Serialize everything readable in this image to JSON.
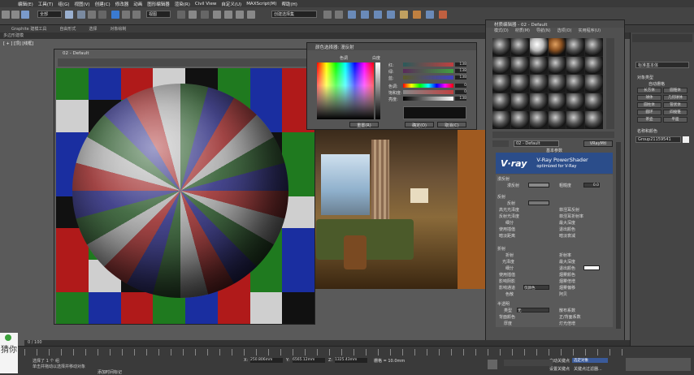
{
  "menubar": {
    "items": [
      "编辑(E)",
      "工具(T)",
      "组(G)",
      "视图(V)",
      "创建(C)",
      "修改器",
      "动画",
      "图形编辑器",
      "渲染(R)",
      "Civil View",
      "自定义(U)",
      "MAXScript(M)",
      "帮助(H)"
    ]
  },
  "toolbar": {
    "selection_filter": "全部",
    "view_dropdown": "视图",
    "named_selection": "创建选择集"
  },
  "ribbon": {
    "tabs": [
      "Graphite 建模工具",
      "自由形式",
      "选择",
      "对象绘制"
    ]
  },
  "subbar": {
    "label": "多边形建模"
  },
  "viewport": {
    "label": "[ + ] [顶] [线框]"
  },
  "material_preview": {
    "title": "02 - Default"
  },
  "color_selector": {
    "title": "颜色选择器: 漫反射",
    "hue_label": "色调",
    "whiteness_label": "白度",
    "sliders": [
      {
        "label": "红:",
        "value": "138"
      },
      {
        "label": "绿:",
        "value": "138"
      },
      {
        "label": "蓝:",
        "value": "138"
      },
      {
        "label": "色调:",
        "value": "0"
      },
      {
        "label": "饱和度:",
        "value": "0"
      },
      {
        "label": "亮度:",
        "value": "138"
      }
    ],
    "reset_button": "重置(R)",
    "ok_button": "确定(O)",
    "cancel_button": "取消(C)"
  },
  "material_editor": {
    "title": "材质编辑器 - 02 - Default",
    "menu": [
      "模式(D)",
      "材质(M)",
      "导航(N)",
      "选项(O)",
      "实用程序(U)"
    ],
    "material_name": "02 - Default",
    "material_type": "VRayMtl",
    "rollout_title": "基本参数",
    "vray_logo": "V·ray",
    "vray_title": "V-Ray PowerShader",
    "vray_subtitle": "optimized for V-Ray",
    "params": {
      "diffuse_section": "漫反射",
      "diffuse": "漫反射",
      "roughness": "粗糙度",
      "roughness_value": "0.0",
      "reflection_section": "反射",
      "reflect": "反射",
      "hilight_gloss": "高光光泽度",
      "refl_gloss": "反射光泽度",
      "subdivs": "细分",
      "use_interp": "使用插值",
      "dim_distance": "暗淡距离",
      "fresnel": "菲涅耳反射",
      "fresnel_ior": "菲涅耳折射率",
      "max_depth": "最大深度",
      "exit_color": "退出颜色",
      "dim_falloff": "暗淡衰减",
      "refraction_section": "折射",
      "refract": "折射",
      "ior": "折射率",
      "glossiness": "光泽度",
      "max_depth2": "最大深度",
      "subdivs2": "细分",
      "exit_color2": "退出颜色",
      "use_interp2": "使用插值",
      "affect_shadows": "影响阴影",
      "fog_color": "烟雾颜色",
      "fog_multiplier": "烟雾倍增",
      "fog_bias": "烟雾偏移",
      "affect_channels": "影响通道",
      "affect_channels_value": "仅颜色",
      "dispersion": "色散",
      "abbe": "阿贝",
      "translucency_section": "半透明",
      "type": "类型",
      "type_value": "无",
      "scatter_coef": "散布系数",
      "back_side": "背面颜色",
      "fwd_bck": "正/背面系数",
      "thickness": "厚度",
      "light_multiplier": "灯光倍增"
    }
  },
  "command_panel": {
    "object_type": "对象类型",
    "dropdown": "标准基本体",
    "auto_grid": "自动栅格",
    "buttons": [
      "长方体",
      "圆锥体",
      "球体",
      "几何球体",
      "圆柱体",
      "管状体",
      "圆环",
      "四棱锥",
      "茶壶",
      "平面"
    ],
    "name_color_label": "名称和颜色",
    "object_name": "Group21159541"
  },
  "timeline": {
    "frame_counter": "0 / 100",
    "status_line1": "选择了 1 个 组",
    "status_line2": "单击并拖动以选择并移动对象",
    "x_label": "X:",
    "x_value": "250.806mm",
    "y_label": "Y:",
    "y_value": "6565.12mm",
    "z_label": "Z:",
    "z_value": "1325.43mm",
    "grid": "栅格 = 10.0mm",
    "autokey": "自动关键点",
    "set_key": "设置关键点",
    "selected": "选定对象",
    "key_filters": "关键点过滤器...",
    "add_time_tag": "添加时间标记"
  },
  "watermark": {
    "text": "猜你"
  }
}
